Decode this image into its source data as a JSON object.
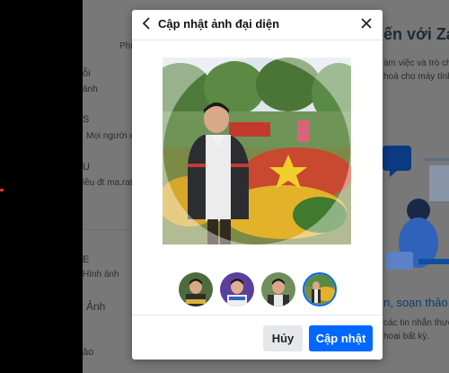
{
  "background": {
    "heading_partial": "ến với Zalo",
    "tab_partial": "Phi",
    "item_1_title": "ỗi",
    "item_1_sub": "ảnh",
    "item_2_title": "S",
    "item_2_sub": "Mọi người c",
    "item_3_title": "U",
    "item_3_sub": "iều đt ma.rat",
    "item_4_label": "Hình ảnh",
    "item_5_title": "Ảnh",
    "item_6_title": "ảo",
    "desc_line_1": "àm việc và trò ch",
    "desc_line_2": "hoá cho máy tính",
    "feature_title": "n, soạn thảo i",
    "feature_line_1": "các tin nhắn thươ",
    "feature_line_2": "hoại bất kỳ."
  },
  "modal": {
    "title": "Cập nhật ảnh đại diện",
    "back_icon": "chevron-left-icon",
    "close_icon": "close-icon",
    "cancel_label": "Hủy",
    "update_label": "Cập nhật",
    "accent_color": "#0068ff"
  },
  "thumbnails": [
    {
      "name": "avatar-option-1",
      "selected": false
    },
    {
      "name": "avatar-option-2",
      "selected": false
    },
    {
      "name": "avatar-option-3",
      "selected": false
    },
    {
      "name": "avatar-option-4",
      "selected": true
    }
  ]
}
